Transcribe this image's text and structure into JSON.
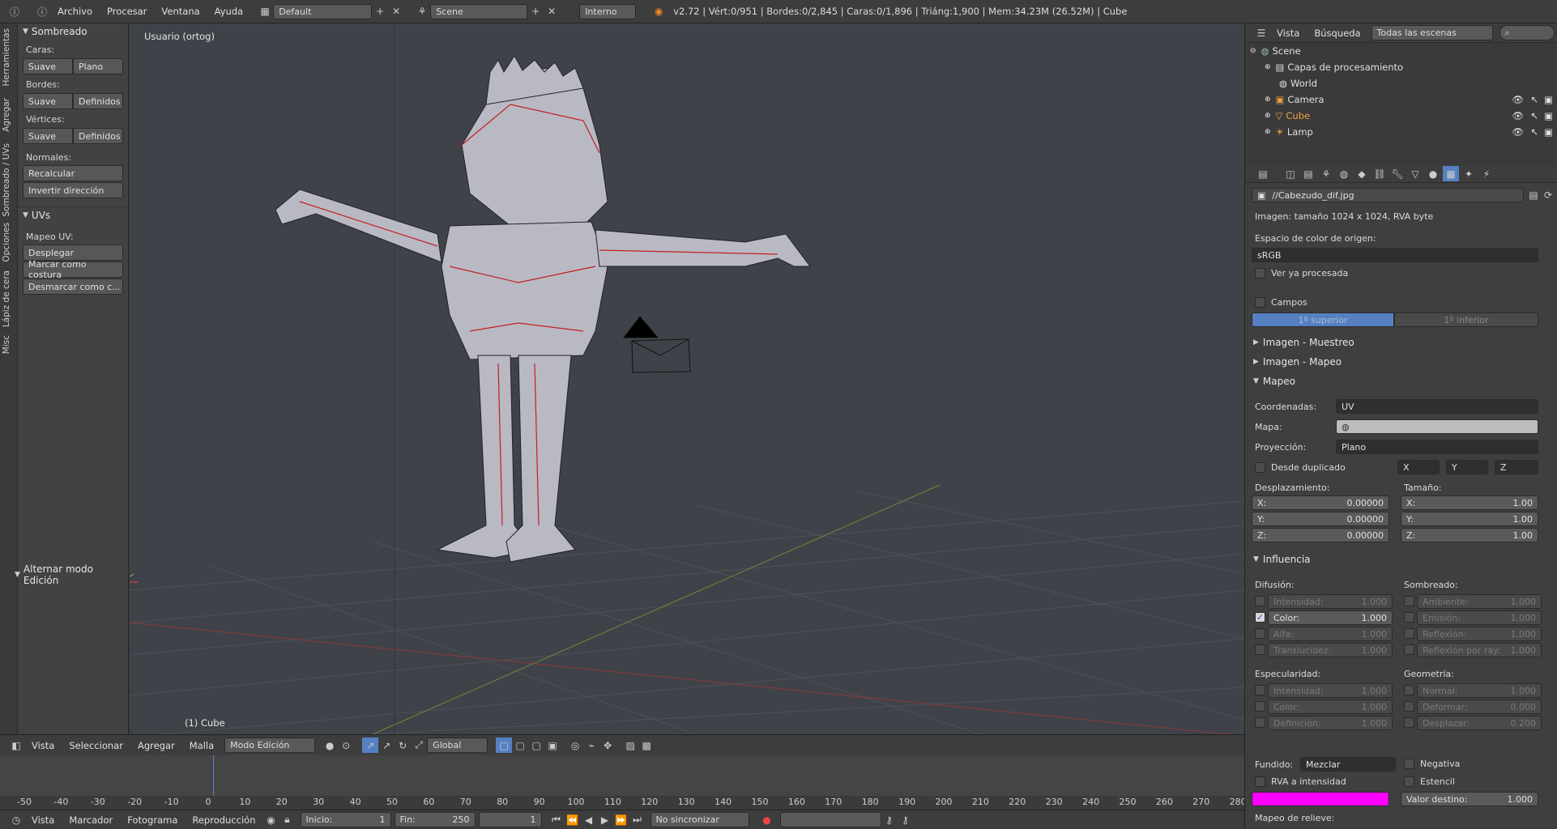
{
  "topbar": {
    "menus": [
      "Archivo",
      "Procesar",
      "Ventana",
      "Ayuda"
    ],
    "layout_value": "Default",
    "scene_value": "Scene",
    "engine_value": "Interno",
    "stats": "v2.72 | Vért:0/951 | Bordes:0/2,845 | Caras:0/1,896 | Triáng:1,900 | Mem:34.23M (26.52M) | Cube"
  },
  "left_tabs": [
    "Herramientas",
    "Agregar",
    "Sombreado / UVs",
    "Opciones",
    "Lápiz de cera",
    "Misc"
  ],
  "toolshelf": {
    "shading_title": "Sombreado",
    "faces_label": "Caras:",
    "edges_label": "Bordes:",
    "verts_label": "Vértices:",
    "smooth": "Suave",
    "flat": "Plano",
    "sharp": "Definidos",
    "normals_label": "Normales:",
    "recalc": "Recalcular",
    "flip": "Invertir dirección",
    "uvs_title": "UVs",
    "uvmap_label": "Mapeo UV:",
    "unwrap": "Desplegar",
    "mark_seam": "Marcar como costura",
    "clear_seam": "Desmarcar como c...",
    "toggle_edit": "Alternar modo Edición"
  },
  "viewport": {
    "label": "Usuario (ortog)",
    "object_label": "(1) Cube"
  },
  "view_header": {
    "menus": [
      "Vista",
      "Seleccionar",
      "Agregar",
      "Malla"
    ],
    "mode": "Modo Edición",
    "orientation": "Global"
  },
  "timeline": {
    "ticks": [
      "-50",
      "-40",
      "-30",
      "-20",
      "-10",
      "0",
      "10",
      "20",
      "30",
      "40",
      "50",
      "60",
      "70",
      "80",
      "90",
      "100",
      "110",
      "120",
      "130",
      "140",
      "150",
      "160",
      "170",
      "180",
      "190",
      "200",
      "210",
      "220",
      "230",
      "240",
      "250",
      "260",
      "270",
      "280"
    ]
  },
  "bottombar": {
    "menus": [
      "Vista",
      "Marcador",
      "Fotograma",
      "Reproducción"
    ],
    "start": "Inicio:",
    "start_val": "1",
    "end": "Fin:",
    "end_val": "250",
    "current": "1",
    "sync": "No sincronizar"
  },
  "outliner": {
    "menus": [
      "Vista",
      "Búsqueda"
    ],
    "scenes_dropdown": "Todas las escenas",
    "items": [
      "Scene",
      "Capas de procesamiento",
      "World",
      "Camera",
      "Cube",
      "Lamp"
    ]
  },
  "props": {
    "image_path": "//Cabezudo_dif.jpg",
    "image_info": "Imagen: tamaño 1024 x 1024, RVA byte",
    "colorspace_label": "Espacio de color de origen:",
    "colorspace_val": "sRGB",
    "view_processed": "Ver ya procesada",
    "fields": "Campos",
    "upper_first": "1º superior",
    "lower_first": "1º inferior",
    "sec_sampling": "Imagen - Muestreo",
    "sec_mapping_img": "Imagen - Mapeo",
    "sec_mapping": "Mapeo",
    "coords_label": "Coordenadas:",
    "coords_val": "UV",
    "map_label": "Mapa:",
    "proj_label": "Proyección:",
    "proj_val": "Plano",
    "from_dupli": "Desde duplicado",
    "axis_x": "X",
    "axis_y": "Y",
    "axis_z": "Z",
    "offset_label": "Desplazamiento:",
    "size_label": "Tamaño:",
    "offset": [
      [
        "X:",
        "0.00000"
      ],
      [
        "Y:",
        "0.00000"
      ],
      [
        "Z:",
        "0.00000"
      ]
    ],
    "size": [
      [
        "X:",
        "1.00"
      ],
      [
        "Y:",
        "1.00"
      ],
      [
        "Z:",
        "1.00"
      ]
    ],
    "sec_influence": "Influencia",
    "diffuse_label": "Difusión:",
    "shading_label": "Sombreado:",
    "diffuse": [
      [
        "Intensidad:",
        "1.000"
      ],
      [
        "Color:",
        "1.000"
      ],
      [
        "Alfa:",
        "1.000"
      ],
      [
        "Translucidez:",
        "1.000"
      ]
    ],
    "shading": [
      [
        "Ambiente:",
        "1.000"
      ],
      [
        "Emisión:",
        "1.000"
      ],
      [
        "Reflexión:",
        "1.000"
      ],
      [
        "Reflexión por ray:",
        "1.000"
      ]
    ],
    "specular_label": "Especularidad:",
    "geometry_label": "Geometría:",
    "specular": [
      [
        "Intensidad:",
        "1.000"
      ],
      [
        "Color:",
        "1.000"
      ],
      [
        "Definición:",
        "1.000"
      ]
    ],
    "geometry": [
      [
        "Normal:",
        "1.000"
      ],
      [
        "Deformar:",
        "0.000"
      ],
      [
        "Desplazar:",
        "0.200"
      ]
    ],
    "blend_label": "Fundido:",
    "blend_val": "Mezclar",
    "negative": "Negativa",
    "rgb_to_int": "RVA a intensidad",
    "stencil": "Estencil",
    "dest_label": "Valor destino:",
    "dest_val": "1.000",
    "bump_label": "Mapeo de relieve:",
    "colors": {
      "accent": "#5680c2",
      "magenta": "#ff00ff",
      "cube": "#f0a040"
    }
  }
}
